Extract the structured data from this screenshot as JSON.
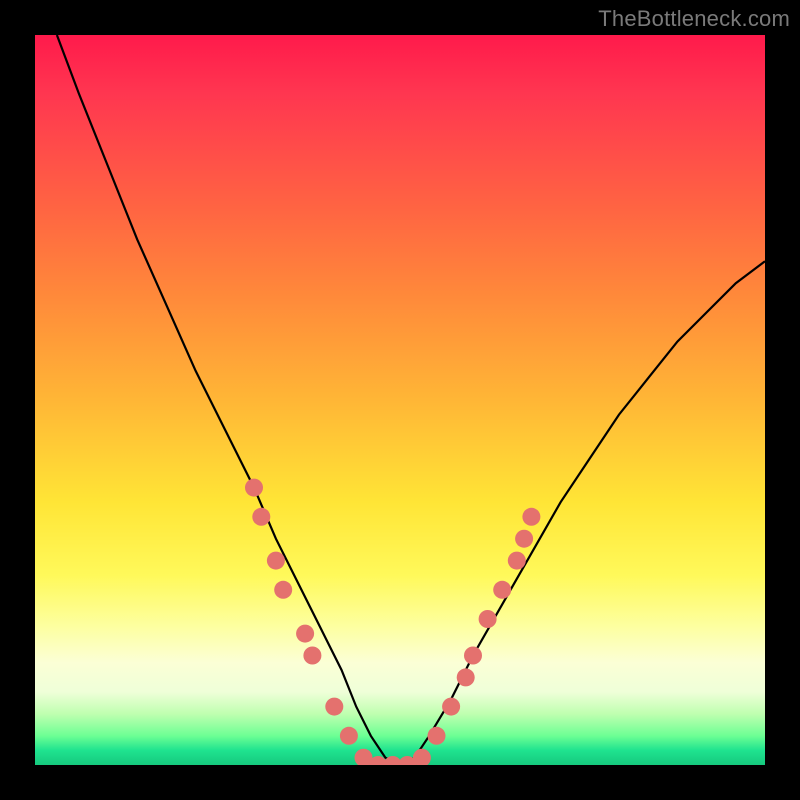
{
  "watermark": "TheBottleneck.com",
  "chart_data": {
    "type": "line",
    "title": "",
    "xlabel": "",
    "ylabel": "",
    "xlim": [
      0,
      100
    ],
    "ylim": [
      0,
      100
    ],
    "background_gradient": {
      "orientation": "vertical",
      "stops": [
        {
          "pos": 0,
          "color": "#ff1a4b"
        },
        {
          "pos": 24,
          "color": "#ff6542"
        },
        {
          "pos": 50,
          "color": "#ffb636"
        },
        {
          "pos": 74,
          "color": "#fff95a"
        },
        {
          "pos": 90,
          "color": "#efffd8"
        },
        {
          "pos": 98,
          "color": "#1fe38f"
        },
        {
          "pos": 100,
          "color": "#16c97e"
        }
      ]
    },
    "series": [
      {
        "name": "bottleneck-curve",
        "color": "#000000",
        "x": [
          3,
          6,
          10,
          14,
          18,
          22,
          26,
          30,
          33,
          36,
          39,
          42,
          44,
          46,
          48,
          50,
          52,
          54,
          57,
          60,
          64,
          68,
          72,
          76,
          80,
          84,
          88,
          92,
          96,
          100
        ],
        "y": [
          100,
          92,
          82,
          72,
          63,
          54,
          46,
          38,
          31,
          25,
          19,
          13,
          8,
          4,
          1,
          0,
          1,
          4,
          9,
          15,
          22,
          29,
          36,
          42,
          48,
          53,
          58,
          62,
          66,
          69
        ]
      }
    ],
    "markers": {
      "name": "highlight-dots",
      "color": "#e4716e",
      "radius": 9,
      "points": [
        {
          "x": 30,
          "y": 38
        },
        {
          "x": 31,
          "y": 34
        },
        {
          "x": 33,
          "y": 28
        },
        {
          "x": 34,
          "y": 24
        },
        {
          "x": 37,
          "y": 18
        },
        {
          "x": 38,
          "y": 15
        },
        {
          "x": 41,
          "y": 8
        },
        {
          "x": 43,
          "y": 4
        },
        {
          "x": 45,
          "y": 1
        },
        {
          "x": 47,
          "y": 0
        },
        {
          "x": 49,
          "y": 0
        },
        {
          "x": 51,
          "y": 0
        },
        {
          "x": 53,
          "y": 1
        },
        {
          "x": 55,
          "y": 4
        },
        {
          "x": 57,
          "y": 8
        },
        {
          "x": 59,
          "y": 12
        },
        {
          "x": 60,
          "y": 15
        },
        {
          "x": 62,
          "y": 20
        },
        {
          "x": 64,
          "y": 24
        },
        {
          "x": 66,
          "y": 28
        },
        {
          "x": 67,
          "y": 31
        },
        {
          "x": 68,
          "y": 34
        }
      ]
    }
  }
}
